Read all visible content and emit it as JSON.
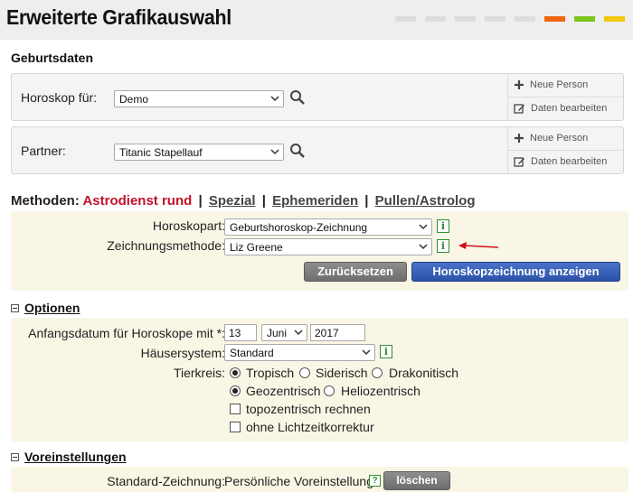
{
  "header": {
    "title": "Erweiterte Grafikauswahl",
    "strip_colors": [
      "#dddddd",
      "#dddddd",
      "#dddddd",
      "#dddddd",
      "#dddddd",
      "#f0660f",
      "#7cc51e",
      "#f2c80f",
      "#2d65c8"
    ]
  },
  "birth_data": {
    "title": "Geburtsdaten",
    "horoscope": {
      "label": "Horoskop für:",
      "value": "Demo",
      "new_person": "Neue Person",
      "edit_data": "Daten bearbeiten"
    },
    "partner": {
      "label": "Partner:",
      "value": "Titanic Stapellauf",
      "new_person": "Neue Person",
      "edit_data": "Daten bearbeiten"
    }
  },
  "methods": {
    "label": "Methoden:",
    "active": "Astrodienst rund",
    "sep": "|",
    "tabs": [
      "Spezial",
      "Ephemeriden",
      "Pullen/Astrolog"
    ]
  },
  "chart_form": {
    "horoscope_type_label": "Horoskopart:",
    "horoscope_type_value": "Geburtshoroskop-Zeichnung",
    "drawing_method_label": "Zeichnungsmethode:",
    "drawing_method_value": "Liz Greene",
    "info": "i",
    "reset_button": "Zurücksetzen",
    "show_button": "Horoskopzeichnung anzeigen"
  },
  "options": {
    "title": "Optionen",
    "start_date_label": "Anfangsdatum für Horoskope mit *:",
    "day": "13",
    "month": "Juni",
    "year": "2017",
    "house_system_label": "Häusersystem:",
    "house_system_value": "Standard",
    "zodiac_label": "Tierkreis:",
    "zodiac_options": [
      "Tropisch",
      "Siderisch",
      "Drakonitisch"
    ],
    "center_options": [
      "Geozentrisch",
      "Heliozentrisch"
    ],
    "checkbox_topo": "topozentrisch rechnen",
    "checkbox_lighttime": "ohne Lichtzeitkorrektur"
  },
  "presets": {
    "title": "Voreinstellungen",
    "standard_label": "Standard-Zeichnung:",
    "standard_value": "Persönliche Voreinstellung",
    "help": "?",
    "delete_button": "löschen"
  }
}
